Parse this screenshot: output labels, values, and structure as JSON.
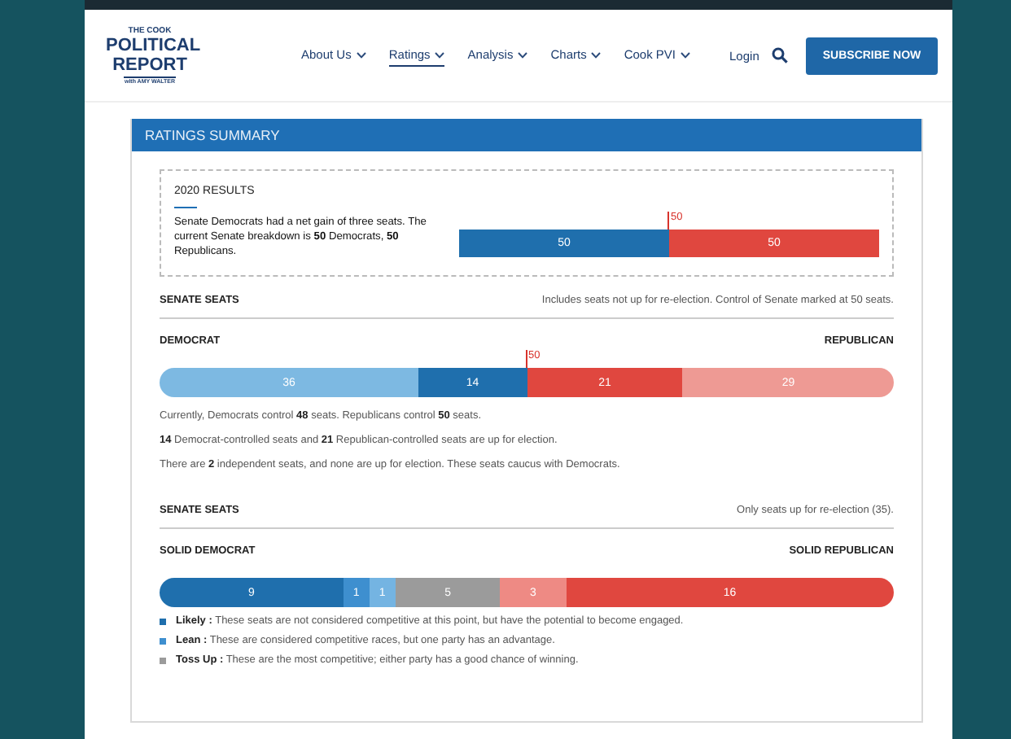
{
  "logo": {
    "top": "THE COOK",
    "main": "POLITICAL REPORT",
    "sub": "with AMY WALTER"
  },
  "nav": [
    {
      "label": "About Us",
      "selected": false
    },
    {
      "label": "Ratings",
      "selected": true
    },
    {
      "label": "Analysis",
      "selected": false
    },
    {
      "label": "Charts",
      "selected": false
    },
    {
      "label": "Cook PVI",
      "selected": false
    }
  ],
  "login": "Login",
  "subscribe": "SUBSCRIBE NOW",
  "panel": {
    "title": "RATINGS SUMMARY",
    "results": {
      "title": "2020 RESULTS",
      "text": "Senate Democrats had a net gain of three seats. The current Senate breakdown is **50** Democrats, **50** Republicans.",
      "bar": [
        {
          "value": "50",
          "color": "#1f6fad"
        },
        {
          "value": "50",
          "color": "#e0473f",
          "marker": "50"
        }
      ]
    },
    "sections": [
      {
        "title": "SENATE SEATS",
        "note": "Includes seats not up for re-election. Control of Senate marked at 50 seats.",
        "left": "DEMOCRAT",
        "right": "REPUBLICAN",
        "bar": [
          {
            "value": "36",
            "color": "#7db9e2"
          },
          {
            "value": "14",
            "color": "#1f6fad"
          },
          {
            "value": "21",
            "color": "#e0473f",
            "marker": "50"
          },
          {
            "value": "29",
            "color": "#ee9a94"
          }
        ],
        "paragraphs": [
          "Currently, Democrats control **48** seats. Republicans control **50** seats.",
          "**14** Democrat-controlled seats and **21** Republican-controlled seats are up for election.",
          "There are **2** independent seats, and none are up for election. These seats caucus with Democrats."
        ]
      },
      {
        "title": "SENATE SEATS",
        "note": "Only seats up for re-election (35).",
        "left": "SOLID DEMOCRAT",
        "right": "SOLID REPUBLICAN",
        "bar": [
          {
            "value": "9",
            "color": "#1f6fad"
          },
          {
            "value": "1",
            "color": "#3e8fcf"
          },
          {
            "value": "1",
            "color": "#74b4e2"
          },
          {
            "value": "5",
            "color": "#9b9b9b"
          },
          {
            "value": "3",
            "color": "#ee8a84"
          },
          {
            "value": "16",
            "color": "#e0473f"
          }
        ],
        "legend": [
          {
            "text": "**Likely :** These seats are not considered competitive at this point, but have the potential to become engaged.",
            "color": "#1f6fad"
          },
          {
            "text": "**Lean :** These are considered competitive races, but one party has an advantage.",
            "color": "#3e8fcf"
          },
          {
            "text": "**Toss Up :** These are the most competitive; either party has a good chance of winning.",
            "color": "#9b9b9b"
          }
        ]
      }
    ]
  }
}
